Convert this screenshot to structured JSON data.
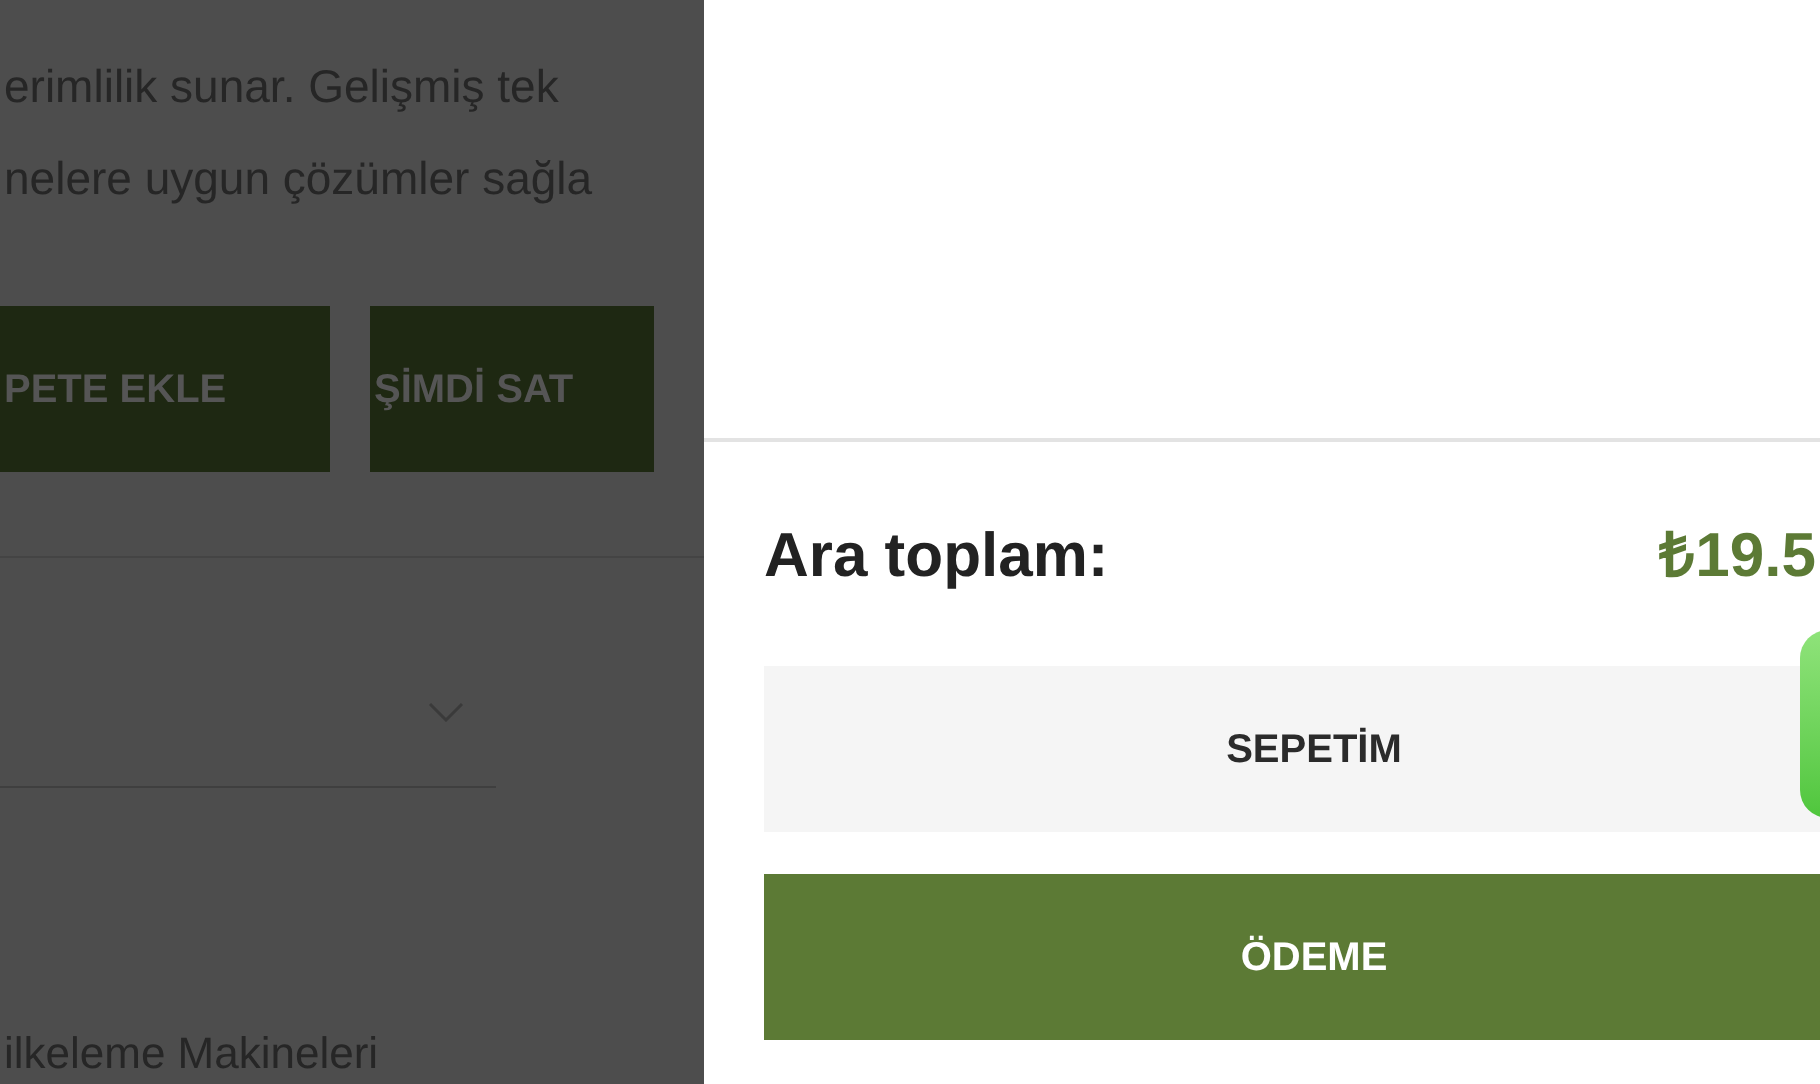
{
  "background_page": {
    "description_lines": [
      "erimlilik sunar. Gelişmiş tek",
      "nelere uygun çözümler sağla"
    ],
    "buttons": [
      "PETE EKLE",
      "ŞİMDİ SAT"
    ],
    "category_heading": "ilkeleme Makineleri"
  },
  "cart_panel": {
    "subtotal_label": "Ara toplam:",
    "subtotal_value": "₺19.5",
    "buttons": [
      {
        "label": "SEPETİM",
        "kind": "secondary"
      },
      {
        "label": "ÖDEME",
        "kind": "primary"
      }
    ]
  }
}
